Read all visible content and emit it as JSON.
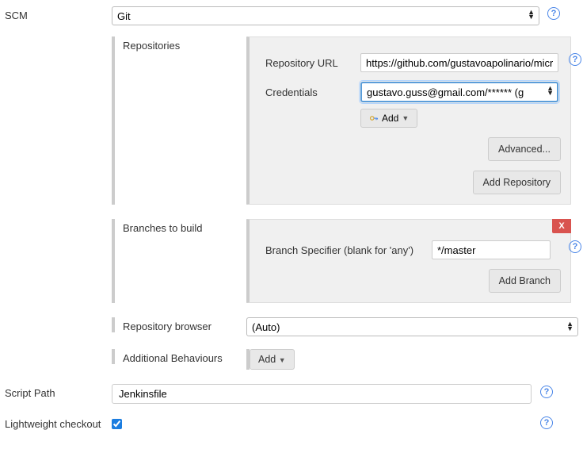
{
  "scm": {
    "label": "SCM",
    "value": "Git"
  },
  "repositories": {
    "label": "Repositories",
    "url": {
      "label": "Repository URL",
      "value": "https://github.com/gustavoapolinario/micro"
    },
    "credentials": {
      "label": "Credentials",
      "value": "gustavo.guss@gmail.com/****** (g"
    },
    "addBtn": "Add",
    "advancedBtn": "Advanced...",
    "addRepoBtn": "Add Repository"
  },
  "branches": {
    "label": "Branches to build",
    "specifier": {
      "label": "Branch Specifier (blank for 'any')",
      "value": "*/master"
    },
    "closeBtn": "X",
    "addBranchBtn": "Add Branch"
  },
  "repoBrowser": {
    "label": "Repository browser",
    "value": "(Auto)"
  },
  "additionalBehaviours": {
    "label": "Additional Behaviours",
    "btn": "Add"
  },
  "scriptPath": {
    "label": "Script Path",
    "value": "Jenkinsfile"
  },
  "lightweight": {
    "label": "Lightweight checkout",
    "checked": true
  }
}
